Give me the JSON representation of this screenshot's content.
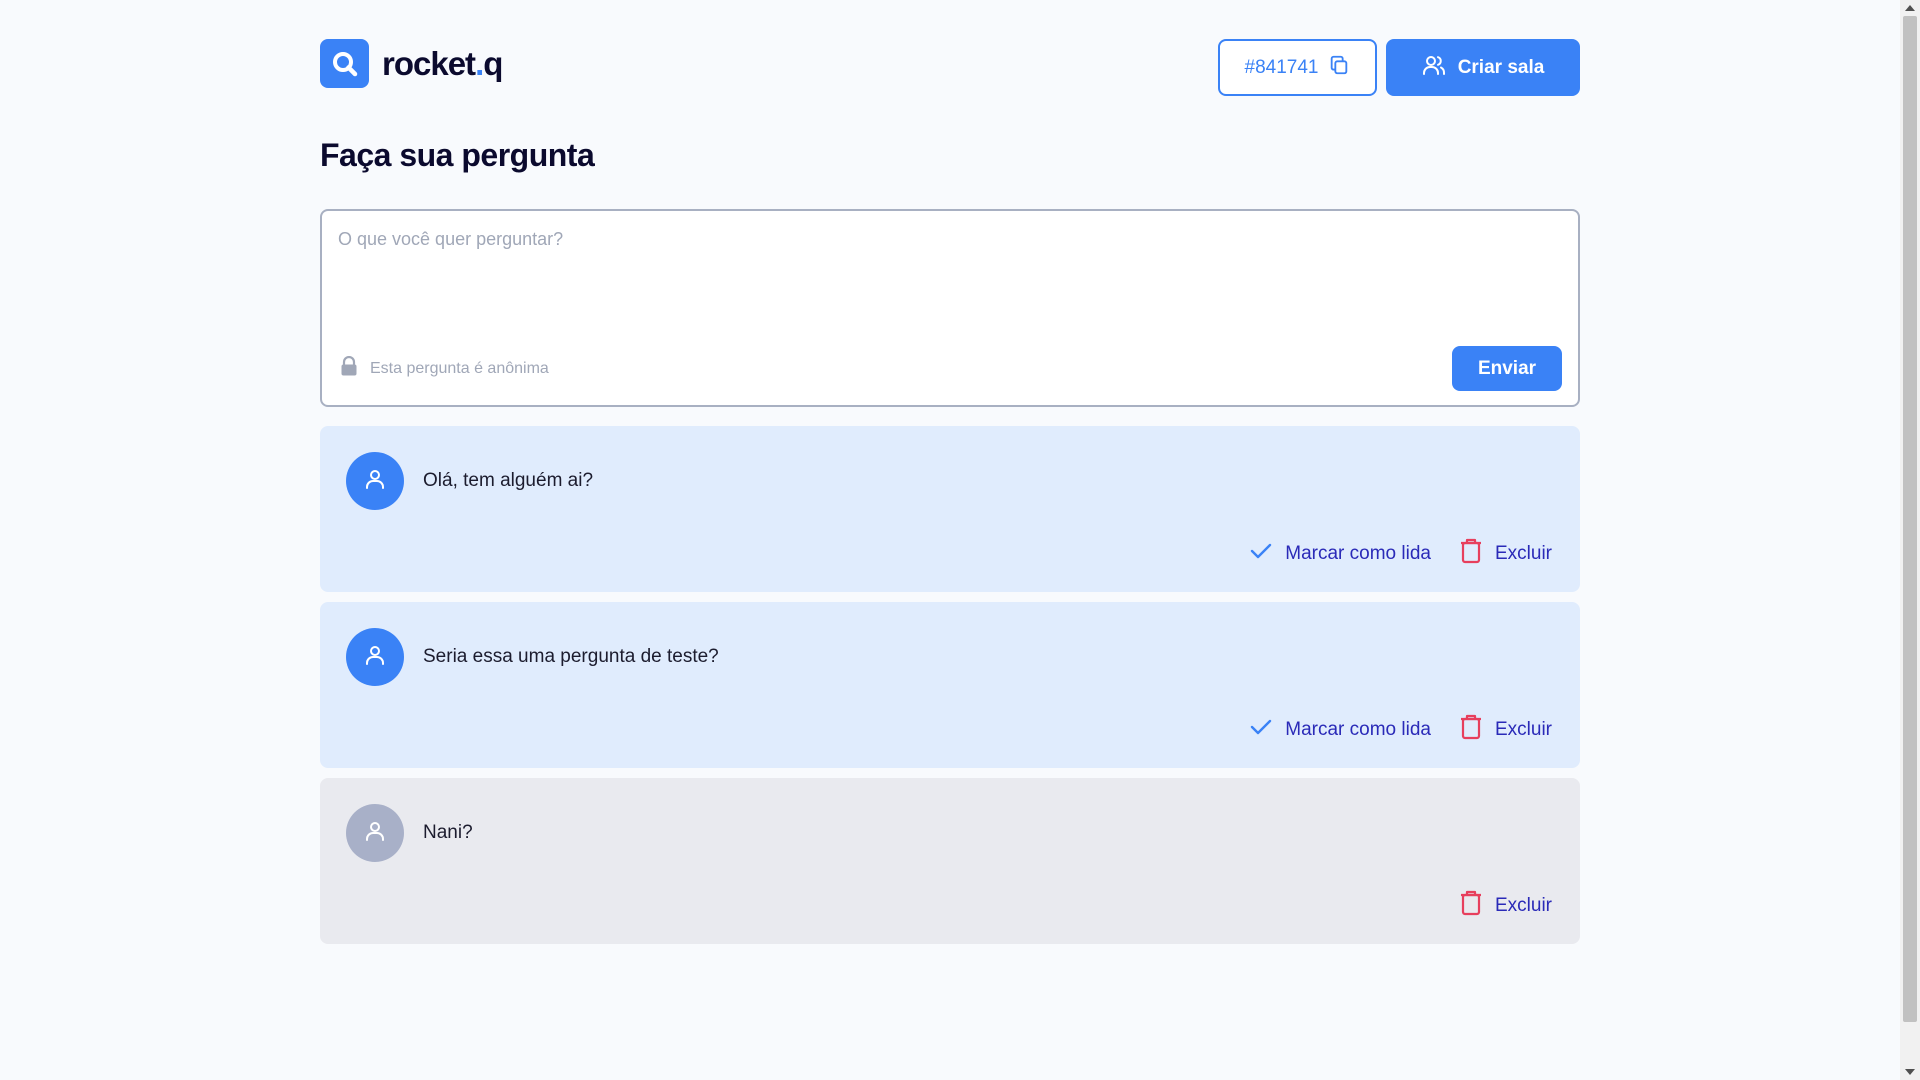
{
  "brand": {
    "name_main": "rocket",
    "name_dot": ".",
    "name_end": "q"
  },
  "header": {
    "room_code": "#841741",
    "create_room_label": "Criar sala"
  },
  "main": {
    "title": "Faça sua pergunta",
    "question_placeholder": "O que você quer perguntar?",
    "anonymous_note": "Esta pergunta é anônima",
    "send_label": "Enviar"
  },
  "questions": [
    {
      "text": "Olá, tem alguém ai?",
      "read": false,
      "mark_read_label": "Marcar como lida",
      "delete_label": "Excluir"
    },
    {
      "text": "Seria essa uma pergunta de teste?",
      "read": false,
      "mark_read_label": "Marcar como lida",
      "delete_label": "Excluir"
    },
    {
      "text": "Nani?",
      "read": true,
      "delete_label": "Excluir"
    }
  ],
  "colors": {
    "accent": "#3a82f6",
    "title": "#0b0a2e",
    "unread_bg": "#e0ecfd",
    "read_bg": "#e9eaef",
    "delete_icon": "#e73f5d",
    "action_text": "#2a2ab8"
  },
  "icons": {
    "logo": "magnifier-logo-icon",
    "copy": "copy-icon",
    "users": "users-icon",
    "lock": "lock-icon",
    "user": "user-icon",
    "check": "check-icon",
    "trash": "trash-icon"
  }
}
